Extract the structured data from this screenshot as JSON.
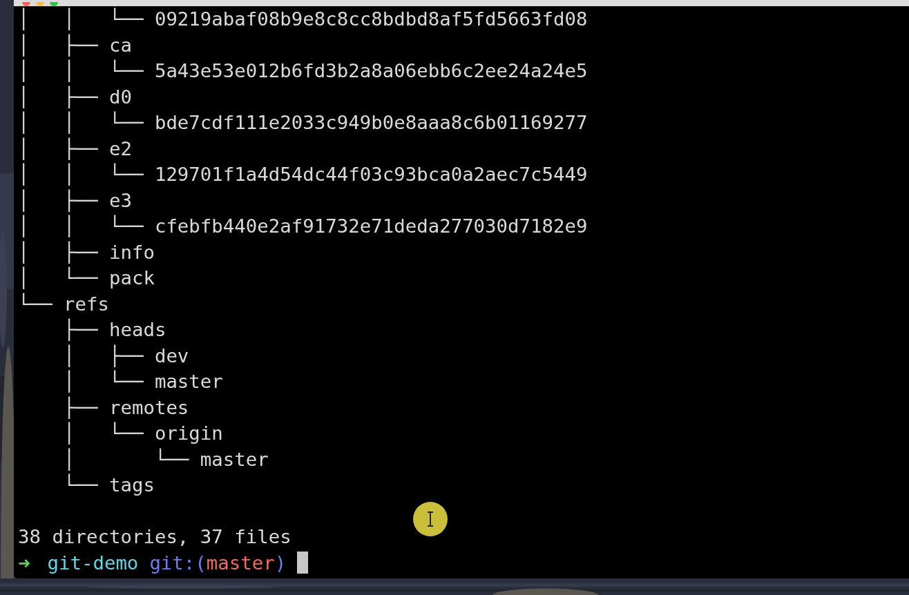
{
  "terminal": {
    "tree_lines": [
      "│   │   └── 09219abaf08b9e8c8cc8bdbd8af5fd5663fd08",
      "│   ├── ca",
      "│   │   └── 5a43e53e012b6fd3b2a8a06ebb6c2ee24a24e5",
      "│   ├── d0",
      "│   │   └── bde7cdf111e2033c949b0e8aaa8c6b01169277",
      "│   ├── e2",
      "│   │   └── 129701f1a4d54dc44f03c93bca0a2aec7c5449",
      "│   ├── e3",
      "│   │   └── cfebfb440e2af91732e71deda277030d7182e9",
      "│   ├── info",
      "│   └── pack",
      "└── refs",
      "    ├── heads",
      "    │   ├── dev",
      "    │   └── master",
      "    ├── remotes",
      "    │   └── origin",
      "    │       └── master",
      "    └── tags"
    ],
    "summary": "38 directories, 37 files",
    "prompt": {
      "arrow": "➜",
      "directory": "git-demo",
      "git_prefix": "git:(",
      "branch": "master",
      "git_suffix": ")"
    }
  }
}
